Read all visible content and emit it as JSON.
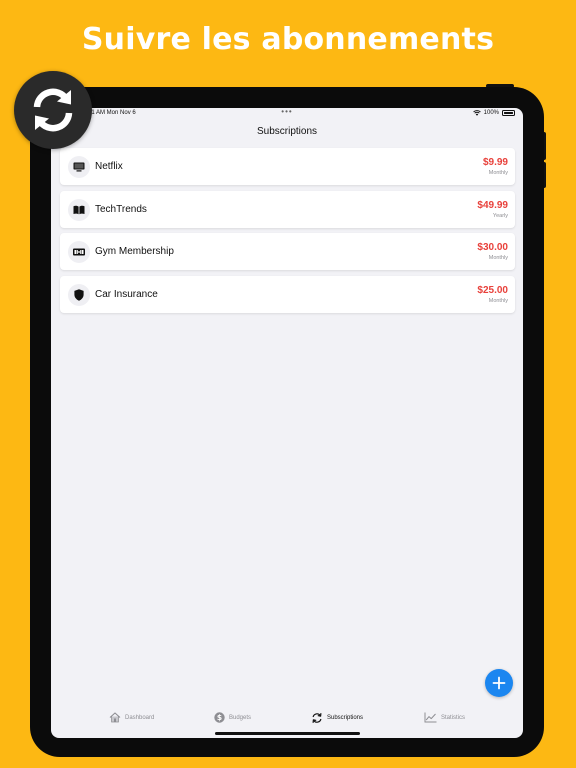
{
  "promo": {
    "headline": "Suivre les abonnements"
  },
  "status_bar": {
    "time": "9:41 AM Mon Nov 6",
    "battery": "100%"
  },
  "nav": {
    "title": "Subscriptions"
  },
  "subscriptions": [
    {
      "name": "Netflix",
      "amount": "$9.99",
      "period": "Monthly",
      "icon": "tv-icon"
    },
    {
      "name": "TechTrends",
      "amount": "$49.99",
      "period": "Yearly",
      "icon": "book-icon"
    },
    {
      "name": "Gym Membership",
      "amount": "$30.00",
      "period": "Monthly",
      "icon": "dumbbell-icon"
    },
    {
      "name": "Car Insurance",
      "amount": "$25.00",
      "period": "Monthly",
      "icon": "shield-icon"
    }
  ],
  "tabs": [
    {
      "label": "Dashboard",
      "icon": "house-icon",
      "active": false
    },
    {
      "label": "Budgets",
      "icon": "dollar-circle-icon",
      "active": false
    },
    {
      "label": "Subscriptions",
      "icon": "refresh-icon",
      "active": true
    },
    {
      "label": "Statistics",
      "icon": "chart-line-icon",
      "active": false
    }
  ],
  "colors": {
    "background": "#FDB813",
    "accent": "#1b86f0",
    "amount": "#e8413b"
  }
}
